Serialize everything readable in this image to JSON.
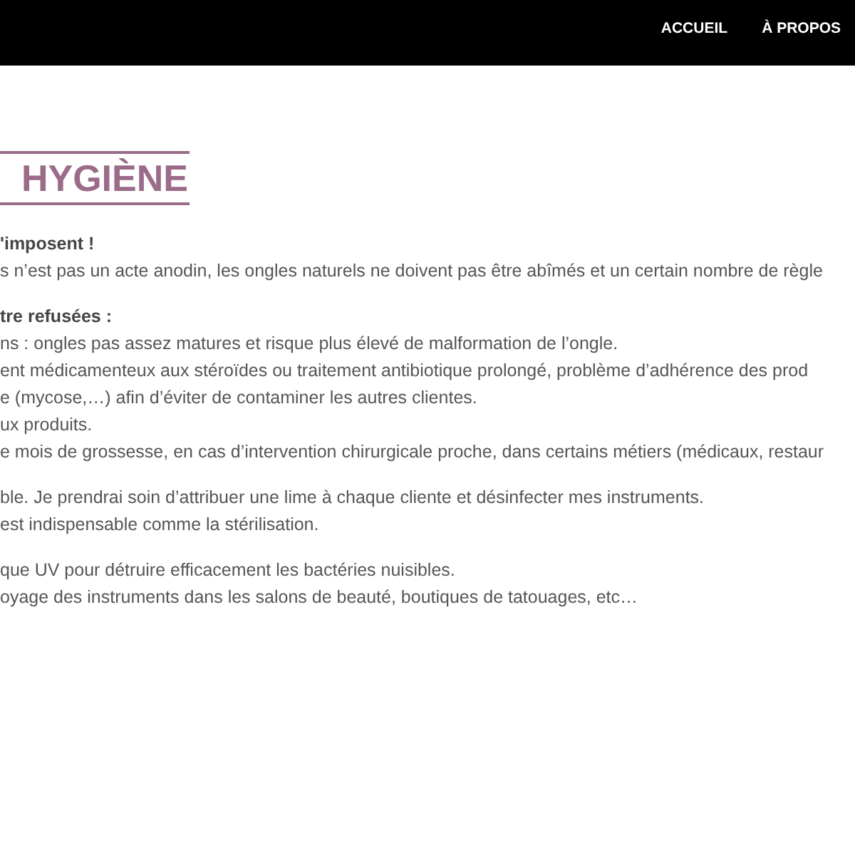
{
  "nav": {
    "items": [
      {
        "label": "ACCUEIL"
      },
      {
        "label": "À PROPOS"
      }
    ]
  },
  "heading": "HYGIÈNE",
  "blocks": [
    {
      "lines": [
        {
          "text": "'imposent !",
          "bold": true
        },
        {
          "text": "s n’est pas un acte anodin, les ongles naturels ne doivent pas être abîmés et un certain nombre de règle",
          "bold": false
        }
      ]
    },
    {
      "lines": [
        {
          "text": "tre refusées :",
          "bold": true
        },
        {
          "text": "ns : ongles pas assez matures et risque plus élevé de malformation de l’ongle.",
          "bold": false
        },
        {
          "text": "ent médicamenteux aux stéroïdes ou traitement antibiotique prolongé, problème d’adhérence des prod",
          "bold": false
        },
        {
          "text": "e (mycose,…) afin d’éviter de contaminer les autres clientes.",
          "bold": false
        },
        {
          "text": "ux produits.",
          "bold": false
        },
        {
          "text": "e mois de grossesse, en cas d’intervention chirurgicale proche, dans certains métiers (médicaux, restaur",
          "bold": false
        }
      ]
    },
    {
      "lines": [
        {
          "text": "ble. Je prendrai soin d’attribuer une lime à chaque cliente et désinfecter mes instruments.",
          "bold": false
        },
        {
          "text": "est indispensable comme la stérilisation.",
          "bold": false
        }
      ]
    },
    {
      "lines": [
        {
          "text": "que UV pour détruire efficacement les bactéries nuisibles.",
          "bold": false
        },
        {
          "text": "oyage des instruments dans les salons de beauté, boutiques de tatouages, etc…",
          "bold": false
        }
      ]
    }
  ]
}
